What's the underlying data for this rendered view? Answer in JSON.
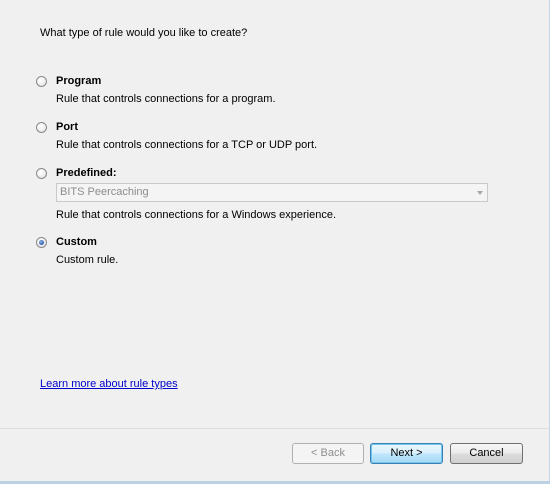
{
  "question": "What type of rule would you like to create?",
  "options": [
    {
      "title": "Program",
      "description": "Rule that controls connections for a program.",
      "checked": false
    },
    {
      "title": "Port",
      "description": "Rule that controls connections for a TCP or UDP port.",
      "checked": false
    },
    {
      "title": "Predefined:",
      "description": "Rule that controls connections for a Windows experience.",
      "checked": false,
      "select_value": "BITS Peercaching"
    },
    {
      "title": "Custom",
      "description": "Custom rule.",
      "checked": true
    }
  ],
  "learn_more": "Learn more about rule types",
  "buttons": {
    "back": "< Back",
    "next": "Next >",
    "cancel": "Cancel"
  }
}
